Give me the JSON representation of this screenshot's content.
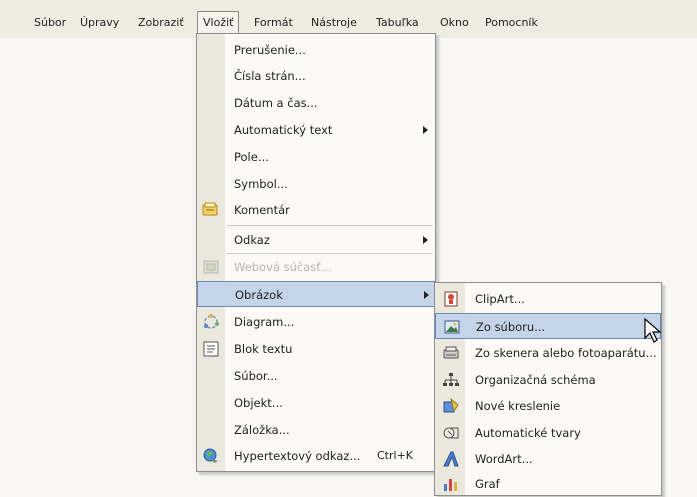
{
  "menubar": {
    "items": [
      {
        "label": "Súbor"
      },
      {
        "label": "Úpravy"
      },
      {
        "label": "Zobraziť"
      },
      {
        "label": "Vložiť"
      },
      {
        "label": "Formát"
      },
      {
        "label": "Nástroje"
      },
      {
        "label": "Tabuľka"
      },
      {
        "label": "Okno"
      },
      {
        "label": "Pomocník"
      }
    ]
  },
  "insert_menu": {
    "items": [
      {
        "label": "Prerušenie..."
      },
      {
        "label": "Čísla strán..."
      },
      {
        "label": "Dátum a čas..."
      },
      {
        "label": "Automatický text"
      },
      {
        "label": "Pole..."
      },
      {
        "label": "Symbol..."
      },
      {
        "label": "Komentár"
      },
      {
        "label": "Odkaz"
      },
      {
        "label": "Webová súčasť..."
      },
      {
        "label": "Obrázok"
      },
      {
        "label": "Diagram..."
      },
      {
        "label": "Blok textu"
      },
      {
        "label": "Súbor..."
      },
      {
        "label": "Objekt..."
      },
      {
        "label": "Záložka..."
      },
      {
        "label": "Hypertextový odkaz...",
        "shortcut": "Ctrl+K"
      }
    ]
  },
  "picture_submenu": {
    "items": [
      {
        "label": "ClipArt..."
      },
      {
        "label": "Zo súboru..."
      },
      {
        "label": "Zo skenera alebo fotoaparátu..."
      },
      {
        "label": "Organizačná schéma"
      },
      {
        "label": "Nové kreslenie"
      },
      {
        "label": "Automatické tvary"
      },
      {
        "label": "WordArt..."
      },
      {
        "label": "Graf"
      }
    ]
  },
  "colors": {
    "highlight": "#c6d4ea",
    "highlight_border": "#6e88b6",
    "menu_bg": "#fbfaf6",
    "gutter": "#ebe8de"
  }
}
